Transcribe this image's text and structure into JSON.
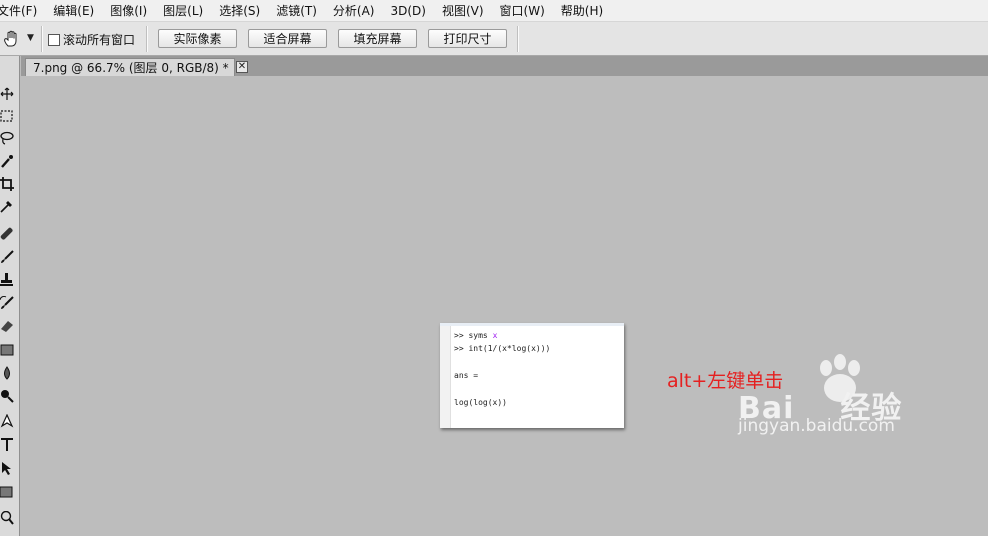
{
  "menu": {
    "items": [
      "文件(F)",
      "编辑(E)",
      "图像(I)",
      "图层(L)",
      "选择(S)",
      "滤镜(T)",
      "分析(A)",
      "3D(D)",
      "视图(V)",
      "窗口(W)",
      "帮助(H)"
    ]
  },
  "options": {
    "scroll_all_label": "滚动所有窗口",
    "scroll_all_checked": false,
    "buttons": [
      "实际像素",
      "适合屏幕",
      "填充屏幕",
      "打印尺寸"
    ]
  },
  "document": {
    "tab_title": "7.png @ 66.7% (图层 0, RGB/8) *",
    "close_glyph": "✕"
  },
  "image_content": {
    "lines": [
      {
        "prompt": ">>",
        "text": "syms ",
        "var": "x"
      },
      {
        "prompt": ">>",
        "text": "int(1/(x*log(x)))"
      },
      {
        "text": "ans ="
      },
      {
        "text": "log(log(x))"
      }
    ]
  },
  "annotation": "alt+左键单击",
  "watermark": {
    "brand": "Bai",
    "brand_tail": "经验",
    "url": "jingyan.baidu.com"
  },
  "icons": [
    "hand-icon",
    "move-icon",
    "marquee-icon",
    "lasso-icon",
    "quick-select-icon",
    "crop-icon",
    "eyedropper-icon",
    "healing-brush-icon",
    "brush-icon",
    "stamp-icon",
    "history-brush-icon",
    "eraser-icon",
    "gradient-icon",
    "blur-icon",
    "dodge-icon",
    "pen-icon",
    "type-icon",
    "path-select-icon",
    "shape-icon",
    "zoom-icon"
  ],
  "colors": {
    "annotation": "#e52020",
    "canvas_bg": "#bdbdbd"
  }
}
